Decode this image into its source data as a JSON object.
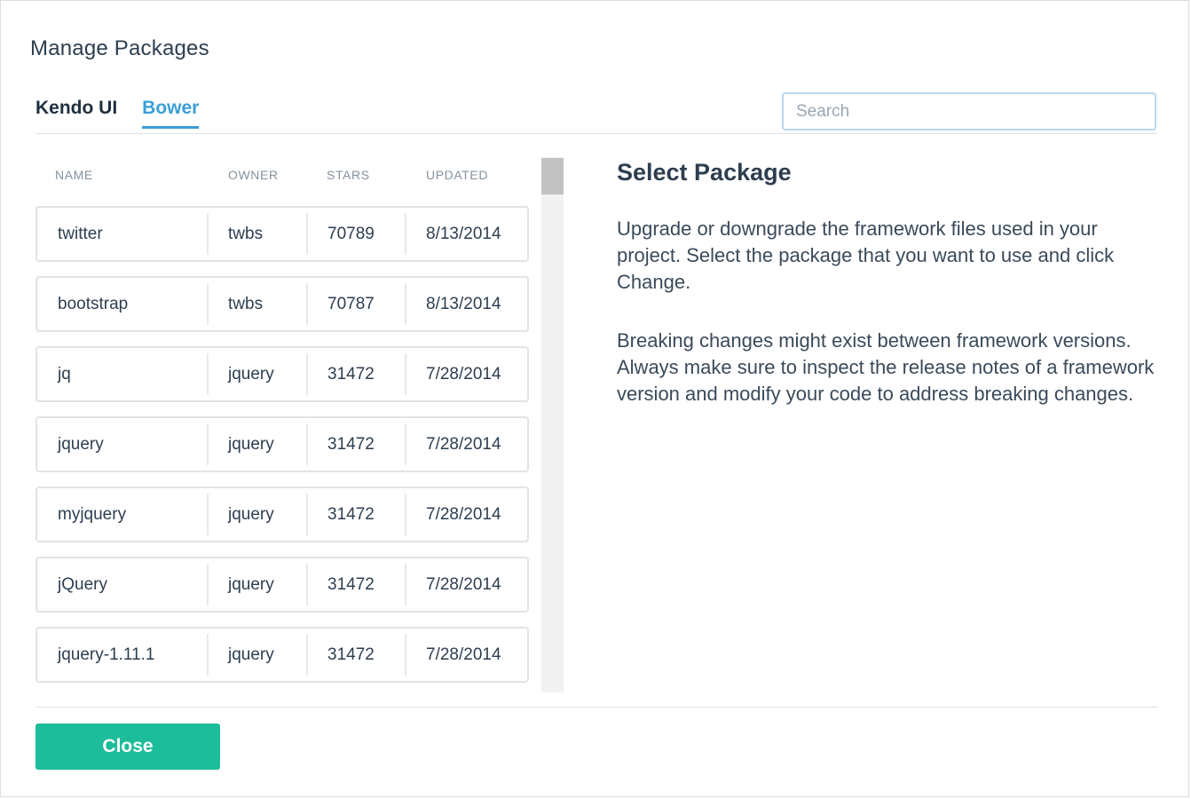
{
  "dialog": {
    "title": "Manage Packages"
  },
  "tabs": [
    {
      "label": "Kendo UI",
      "active": false
    },
    {
      "label": "Bower",
      "active": true
    }
  ],
  "search": {
    "placeholder": "Search",
    "value": ""
  },
  "table": {
    "columns": [
      "NAME",
      "OWNER",
      "STARS",
      "UPDATED"
    ],
    "rows": [
      {
        "name": "twitter",
        "owner": "twbs",
        "stars": "70789",
        "updated": "8/13/2014"
      },
      {
        "name": "bootstrap",
        "owner": "twbs",
        "stars": "70787",
        "updated": "8/13/2014"
      },
      {
        "name": "jq",
        "owner": "jquery",
        "stars": "31472",
        "updated": "7/28/2014"
      },
      {
        "name": "jquery",
        "owner": "jquery",
        "stars": "31472",
        "updated": "7/28/2014"
      },
      {
        "name": "myjquery",
        "owner": "jquery",
        "stars": "31472",
        "updated": "7/28/2014"
      },
      {
        "name": "jQuery",
        "owner": "jquery",
        "stars": "31472",
        "updated": "7/28/2014"
      },
      {
        "name": "jquery-1.11.1",
        "owner": "jquery",
        "stars": "31472",
        "updated": "7/28/2014"
      }
    ]
  },
  "detail": {
    "heading": "Select Package",
    "paragraph1": "Upgrade or downgrade the framework files used in your project. Select the package that you want to use and click Change.",
    "paragraph2": "Breaking changes might exist between framework versions. Always make sure to inspect the release notes of a framework version and modify your code to address breaking changes."
  },
  "footer": {
    "close_label": "Close"
  },
  "colors": {
    "accent": "#3b9fd8",
    "primary_button": "#1dbc9a",
    "text": "#2d3e50"
  }
}
